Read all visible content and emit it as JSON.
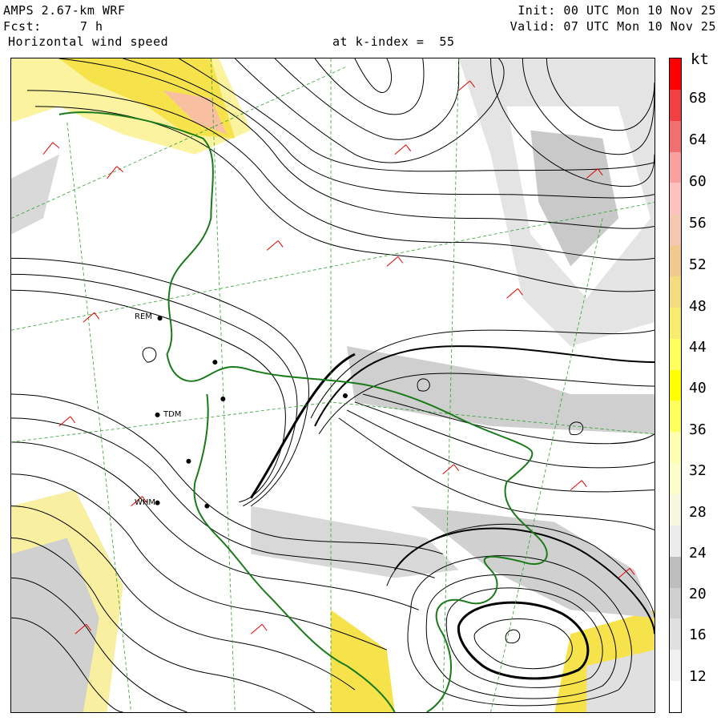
{
  "header": {
    "model": "AMPS 2.67-km WRF",
    "fcst_label": "Fcst:",
    "fcst_value": "7 h",
    "field": "Horizontal wind speed",
    "level": "at k-index =  55",
    "init": "Init: 00 UTC Mon 10 Nov 25",
    "valid": "Valid: 07 UTC Mon 10 Nov 25"
  },
  "legend": {
    "unit": "kt",
    "labels": [
      "68",
      "64",
      "60",
      "56",
      "52",
      "48",
      "44",
      "40",
      "36",
      "32",
      "28",
      "24",
      "20",
      "16",
      "12"
    ],
    "bands": [
      "#ffffff",
      "#f0f0f0",
      "#e0e0e0",
      "#cfcfcf",
      "#bdbdbd",
      "#ececec",
      "#f7f7e0",
      "#fdfdc8",
      "#fefeb0",
      "#ffff60",
      "#ffff00",
      "#ffff60",
      "#f8ec70",
      "#f3dc80",
      "#f1c98f",
      "#f4c8b0",
      "#ffc0c0",
      "#f9a0a0",
      "#f07070",
      "#f04040",
      "#ff0000"
    ]
  },
  "stations": [
    {
      "label": "TDM"
    },
    {
      "label": "WHM"
    },
    {
      "label": "REM"
    }
  ],
  "colors": {
    "coast": "#1a7a1a",
    "barb": "#e00000",
    "grid": "#2f9e2f",
    "stream": "#000000"
  }
}
